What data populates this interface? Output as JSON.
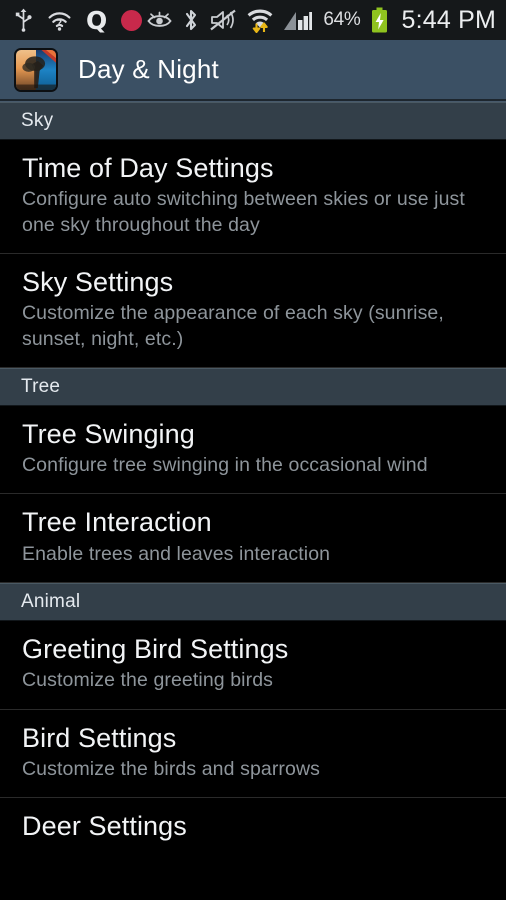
{
  "status_bar": {
    "icons_left": [
      {
        "name": "usb-icon",
        "glyph": "usb"
      },
      {
        "name": "wifi-unknown-icon",
        "glyph": "wifi-question"
      },
      {
        "name": "q-app-icon",
        "label": "Q"
      },
      {
        "name": "recording-dot-icon",
        "color": "#c8294b"
      }
    ],
    "icons_right": [
      {
        "name": "smart-stay-eye-icon",
        "glyph": "eye"
      },
      {
        "name": "bluetooth-icon",
        "glyph": "bluetooth"
      },
      {
        "name": "sound-mute-icon",
        "glyph": "speaker-muted"
      },
      {
        "name": "wifi-transfer-icon",
        "glyph": "wifi-arrows"
      },
      {
        "name": "cellular-signal-icon",
        "glyph": "signal-bars"
      }
    ],
    "battery_percent": "64%",
    "battery_charging": true,
    "battery_color": "#8fc31f",
    "time": "5:44 PM"
  },
  "app_bar": {
    "title": "Day & Night",
    "icon_name": "day-night-app-icon",
    "background": "#3b5064"
  },
  "sections": [
    {
      "header": "Sky",
      "items": [
        {
          "title": "Time of Day Settings",
          "subtitle": "Configure auto switching between skies or use just one sky throughout the day"
        },
        {
          "title": "Sky Settings",
          "subtitle": "Customize the appearance of each sky (sunrise, sunset, night, etc.)"
        }
      ]
    },
    {
      "header": "Tree",
      "items": [
        {
          "title": "Tree Swinging",
          "subtitle": "Configure tree swinging in the occasional wind"
        },
        {
          "title": "Tree Interaction",
          "subtitle": "Enable trees and leaves interaction"
        }
      ]
    },
    {
      "header": "Animal",
      "items": [
        {
          "title": "Greeting Bird Settings",
          "subtitle": "Customize the greeting birds"
        },
        {
          "title": "Bird Settings",
          "subtitle": "Customize the birds and sparrows"
        },
        {
          "title": "Deer Settings",
          "subtitle": ""
        }
      ]
    }
  ],
  "colors": {
    "list_background": "#000000",
    "section_header_background": "#333f49",
    "title_text": "#f2f4f6",
    "subtitle_text": "#8e959b",
    "divider": "#2a2a2a"
  }
}
